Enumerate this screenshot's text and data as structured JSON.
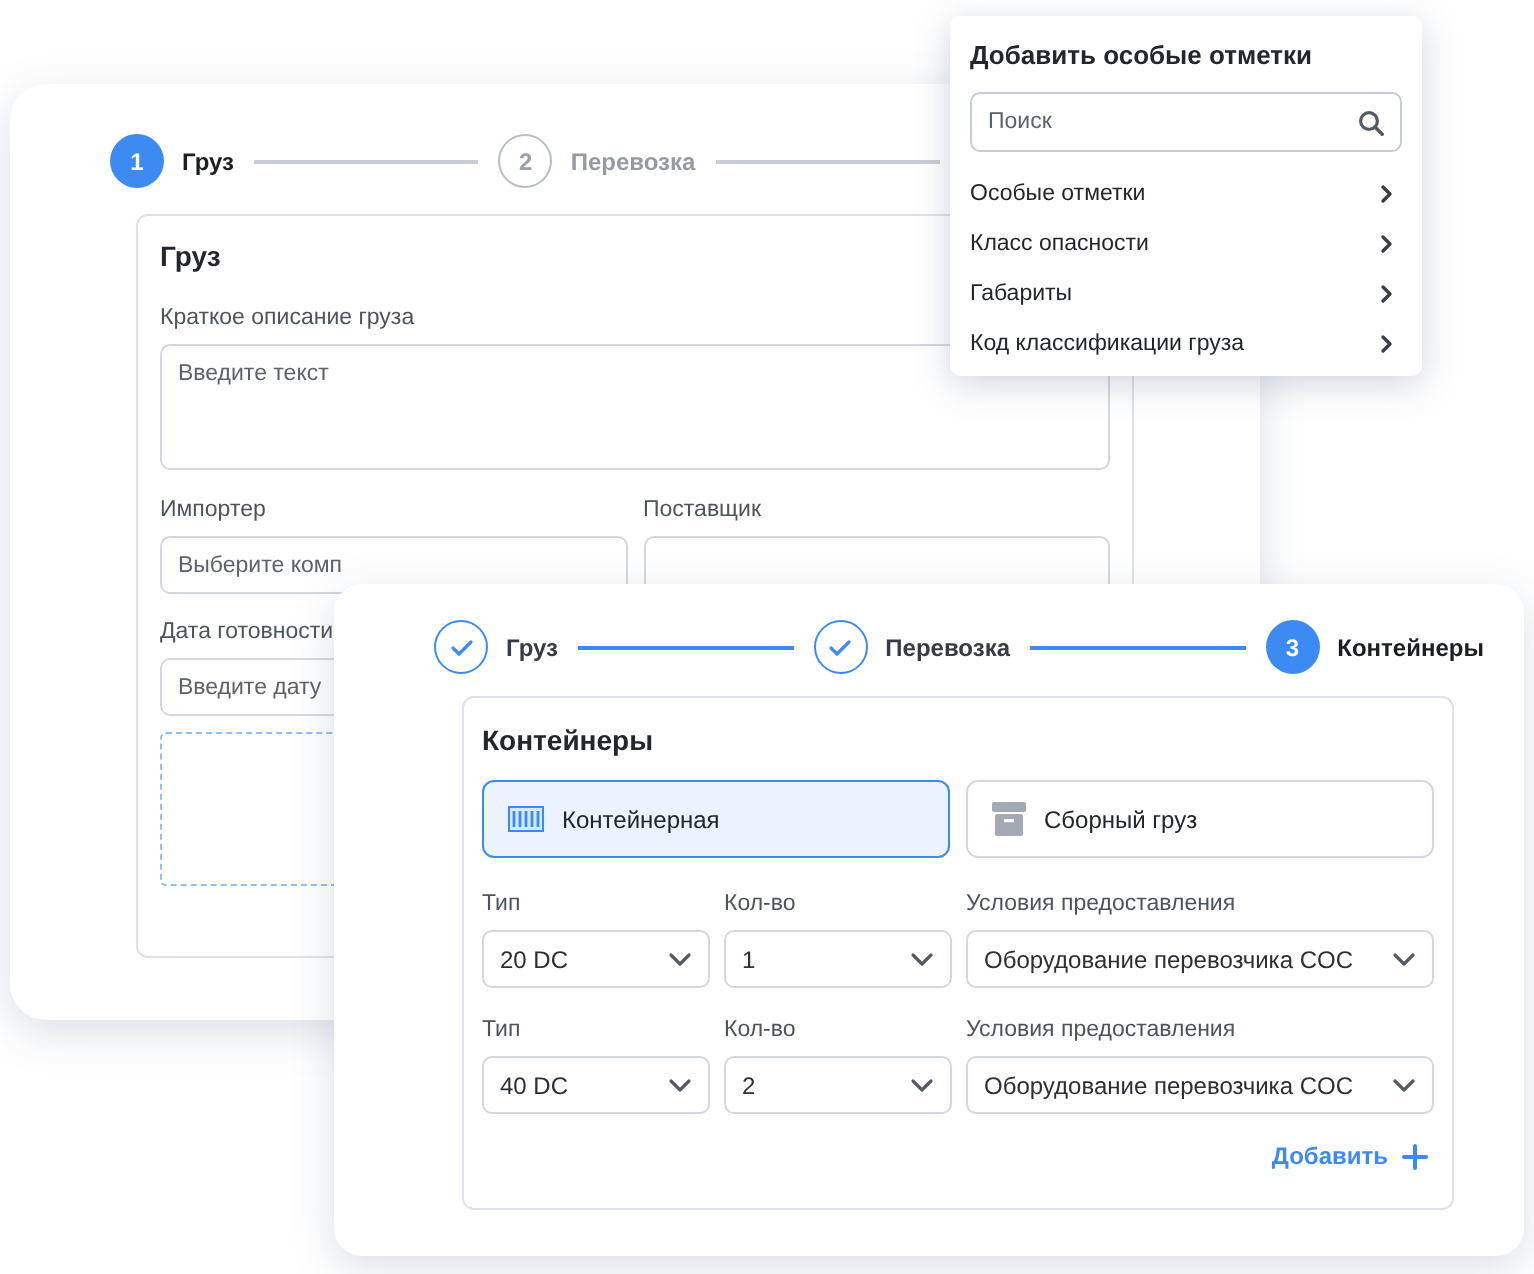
{
  "back_form": {
    "steps": [
      {
        "number": "1",
        "label": "Груз",
        "completed": false,
        "selected": true
      },
      {
        "number": "2",
        "label": "Перевозка",
        "completed": false,
        "selected": false
      }
    ],
    "section_title": "Груз",
    "description": {
      "label": "Краткое описание груза",
      "placeholder": "Введите текст"
    },
    "importer": {
      "label": "Импортер",
      "placeholder": "Выберите комп"
    },
    "supplier": {
      "label": "Поставщик"
    },
    "ready_date": {
      "label": "Дата готовности",
      "placeholder": "Введите дату"
    }
  },
  "marks_popup": {
    "title": "Добавить особые отметки",
    "search": {
      "placeholder": "Поиск"
    },
    "items": [
      "Особые отметки",
      "Класс опасности",
      "Габариты",
      "Код классификации груза"
    ]
  },
  "containers_form": {
    "steps": [
      {
        "label": "Груз",
        "completed": true,
        "selected": false
      },
      {
        "label": "Перевозка",
        "completed": true,
        "selected": false
      },
      {
        "number": "3",
        "label": "Контейнеры",
        "completed": false,
        "selected": true
      }
    ],
    "section_title": "Контейнеры",
    "modes": [
      {
        "label": "Контейнерная",
        "kind": "container",
        "selected": true
      },
      {
        "label": "Сборный груз",
        "kind": "archive",
        "selected": false
      }
    ],
    "rows": [
      {
        "type": {
          "label": "Тип",
          "value": "20 DC"
        },
        "qty": {
          "label": "Кол-во",
          "value": "1"
        },
        "terms": {
          "label": "Условия предоставления",
          "value": "Оборудование перевозчика COC"
        }
      },
      {
        "type": {
          "label": "Тип",
          "value": "40 DC"
        },
        "qty": {
          "label": "Кол-во",
          "value": "2"
        },
        "terms": {
          "label": "Условия предоставления",
          "value": "Оборудование перевозчика COC"
        }
      }
    ],
    "add_button": "Добавить"
  }
}
